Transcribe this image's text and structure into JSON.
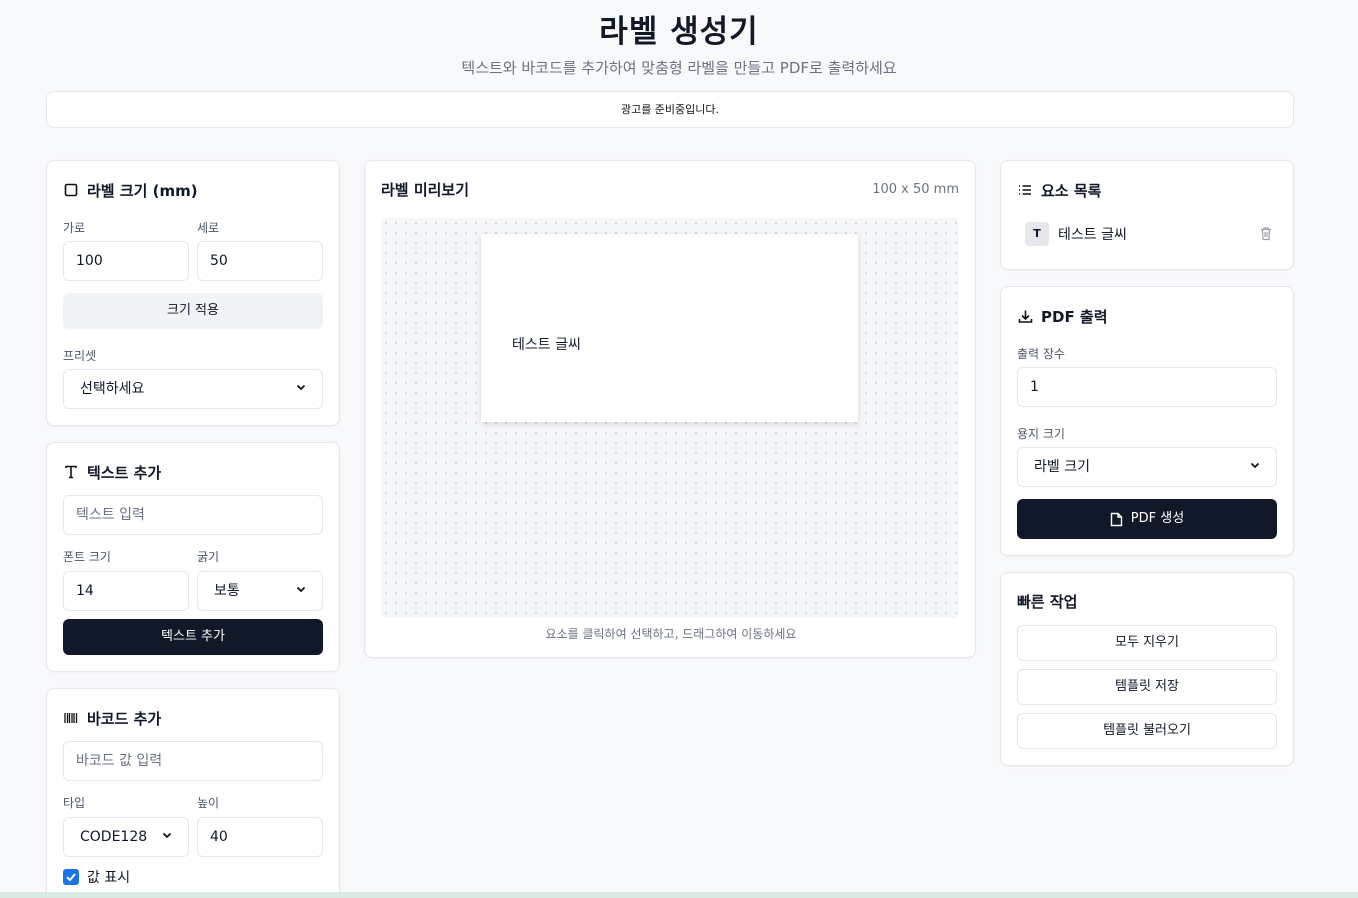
{
  "header": {
    "title": "라벨 생성기",
    "subtitle": "텍스트와 바코드를 추가하여 맞춤형 라벨을 만들고 PDF로 출력하세요"
  },
  "ad": {
    "text": "광고를 준비중입니다."
  },
  "size_card": {
    "title": "라벨 크기 (mm)",
    "width_label": "가로",
    "width_value": "100",
    "height_label": "세로",
    "height_value": "50",
    "apply_label": "크기 적용",
    "preset_label": "프리셋",
    "preset_value": "선택하세요"
  },
  "text_card": {
    "title": "텍스트 추가",
    "input_placeholder": "텍스트 입력",
    "font_size_label": "폰트 크기",
    "font_size_value": "14",
    "weight_label": "굵기",
    "weight_value": "보통",
    "add_label": "텍스트 추가"
  },
  "barcode_card": {
    "title": "바코드 추가",
    "input_placeholder": "바코드 값 입력",
    "type_label": "타입",
    "type_value": "CODE128",
    "height_label": "높이",
    "height_value": "40",
    "show_value_label": "값 표시",
    "show_value_checked": true
  },
  "preview": {
    "title": "라벨 미리보기",
    "size_text": "100 x 50 mm",
    "canvas_text": "테스트 글씨",
    "hint": "요소를 클릭하여 선택하고, 드래그하여 이동하세요"
  },
  "elements_card": {
    "title": "요소 목록",
    "items": [
      {
        "type_badge": "T",
        "label": "테스트 글씨"
      }
    ]
  },
  "pdf_card": {
    "title": "PDF 출력",
    "copies_label": "출력 장수",
    "copies_value": "1",
    "paper_label": "용지 크기",
    "paper_value": "라벨 크기",
    "generate_label": "PDF 생성"
  },
  "quick_card": {
    "title": "빠른 작업",
    "clear_label": "모두 지우기",
    "save_label": "템플릿 저장",
    "load_label": "템플릿 불러오기"
  },
  "colors": {
    "primary": "#111827",
    "checkbox": "#1a73e8"
  }
}
